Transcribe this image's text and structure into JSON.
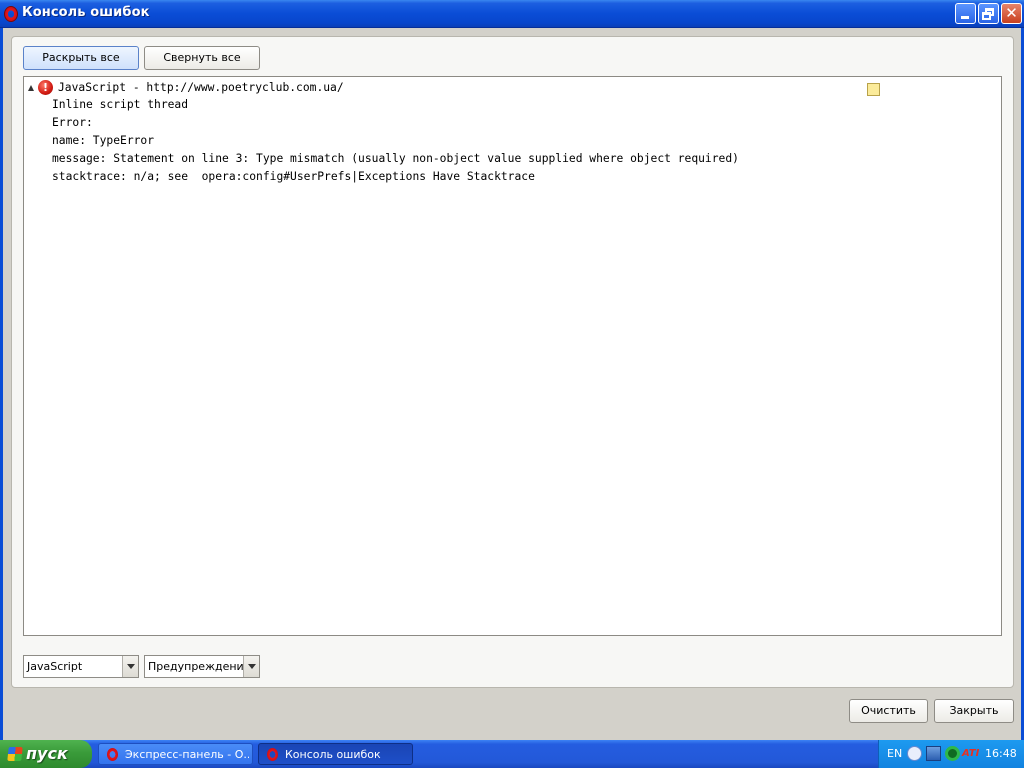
{
  "window": {
    "title": "Консоль ошибок"
  },
  "toolbar": {
    "expand_all": "Раскрыть все",
    "collapse_all": "Свернуть все"
  },
  "console": {
    "entry": {
      "title": "JavaScript - http://www.poetryclub.com.ua/",
      "lines": [
        "Inline script thread",
        "Error:",
        "name: TypeError",
        "message: Statement on line 3: Type mismatch (usually non-object value supplied where object required)",
        "stacktrace: n/a; see  opera:config#UserPrefs|Exceptions Have Stacktrace"
      ]
    }
  },
  "filters": {
    "type_selected": "JavaScript",
    "level_selected": "Предупреждения"
  },
  "footer": {
    "clear": "Очистить",
    "close": "Закрыть"
  },
  "taskbar": {
    "start": "пуск",
    "tasks": [
      {
        "label": "Экспресс-панель - О..."
      },
      {
        "label": "Консоль ошибок"
      }
    ],
    "tray": {
      "language": "EN",
      "ati": "ATI",
      "clock": "16:48"
    }
  },
  "colors": {
    "titlebar": "#0a4dd6",
    "error_icon": "#d11a12",
    "taskbar": "#245de0",
    "start_button": "#3a9b3a"
  }
}
